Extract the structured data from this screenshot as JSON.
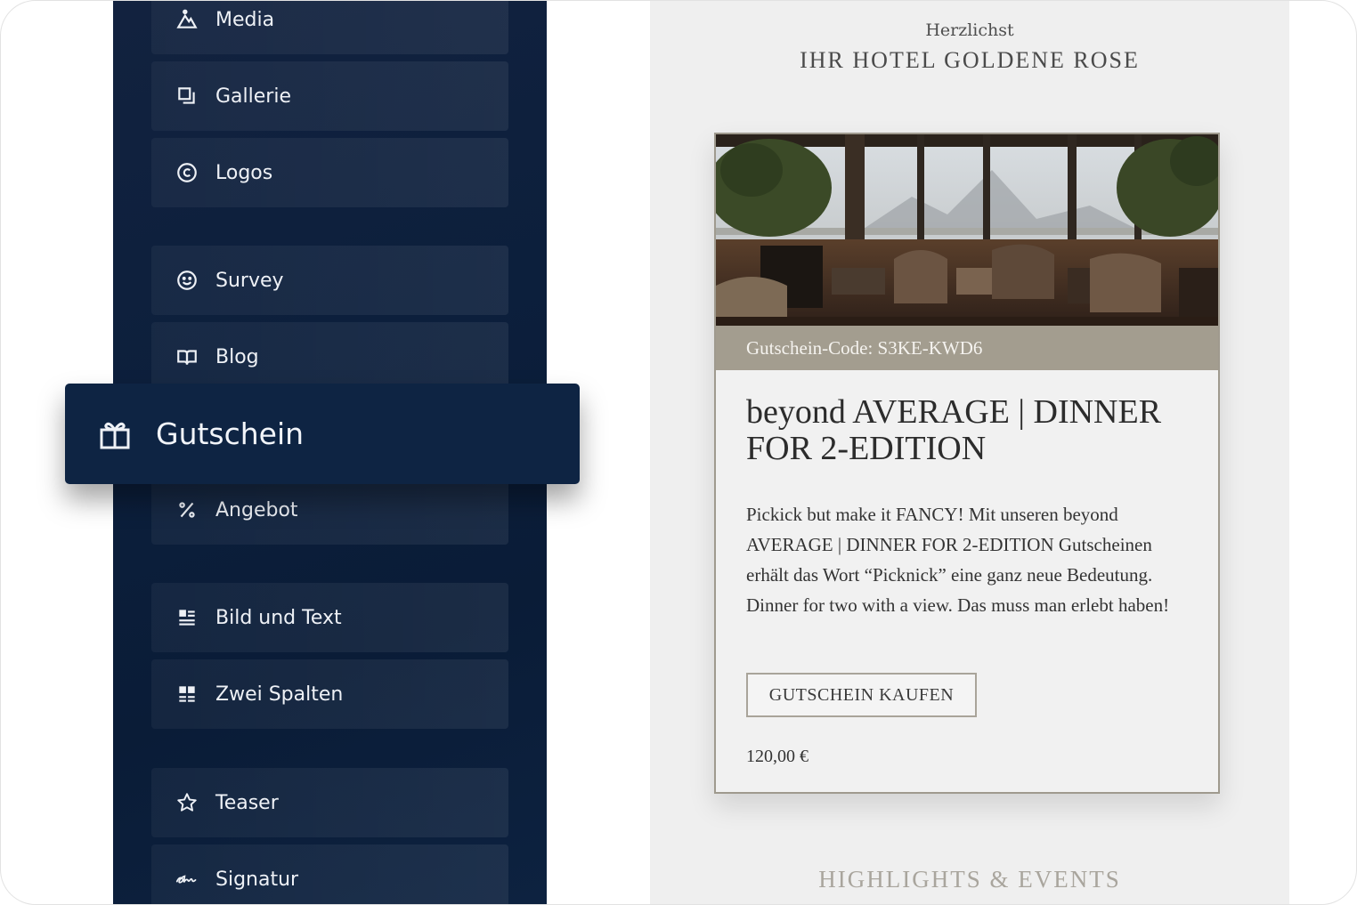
{
  "sidebar": {
    "items": [
      {
        "label": "Media",
        "icon": "mountain-icon"
      },
      {
        "label": "Gallerie",
        "icon": "gallery-icon"
      },
      {
        "label": "Logos",
        "icon": "copyright-icon"
      },
      {
        "label": "Survey",
        "icon": "smiley-icon"
      },
      {
        "label": "Blog",
        "icon": "book-icon"
      },
      {
        "label": "Angebot",
        "icon": "percent-icon"
      },
      {
        "label": "Bild und Text",
        "icon": "image-text-icon"
      },
      {
        "label": "Zwei Spalten",
        "icon": "two-columns-icon"
      },
      {
        "label": "Teaser",
        "icon": "star-icon"
      },
      {
        "label": "Signatur",
        "icon": "signature-icon"
      }
    ],
    "active_item": {
      "label": "Gutschein",
      "icon": "gift-icon"
    }
  },
  "email": {
    "greeting": "Herzlichst",
    "hotel_name": "IHR HOTEL GOLDENE ROSE",
    "voucher": {
      "code_label": "Gutschein-Code: S3KE-KWD6",
      "title": "beyond AVERAGE | DINNER FOR 2-EDITION",
      "description": "Pickick but make it FANCY! Mit unseren beyond AVERAGE | DINNER FOR 2-EDITION Gutscheinen erhält das Wort “Picknick” eine ganz neue Bedeutung. Dinner for two with a view. Das muss man erlebt haben!",
      "button_label": "GUTSCHEIN KAUFEN",
      "price": "120,00 €"
    },
    "next_section": "HIGHLIGHTS & EVENTS"
  },
  "colors": {
    "sidebar_bg": "#0c1f3c",
    "active_bg": "#0e2443",
    "email_bg": "#efefef",
    "code_bar": "#a39d8f",
    "card_border": "#9f9a8e"
  }
}
